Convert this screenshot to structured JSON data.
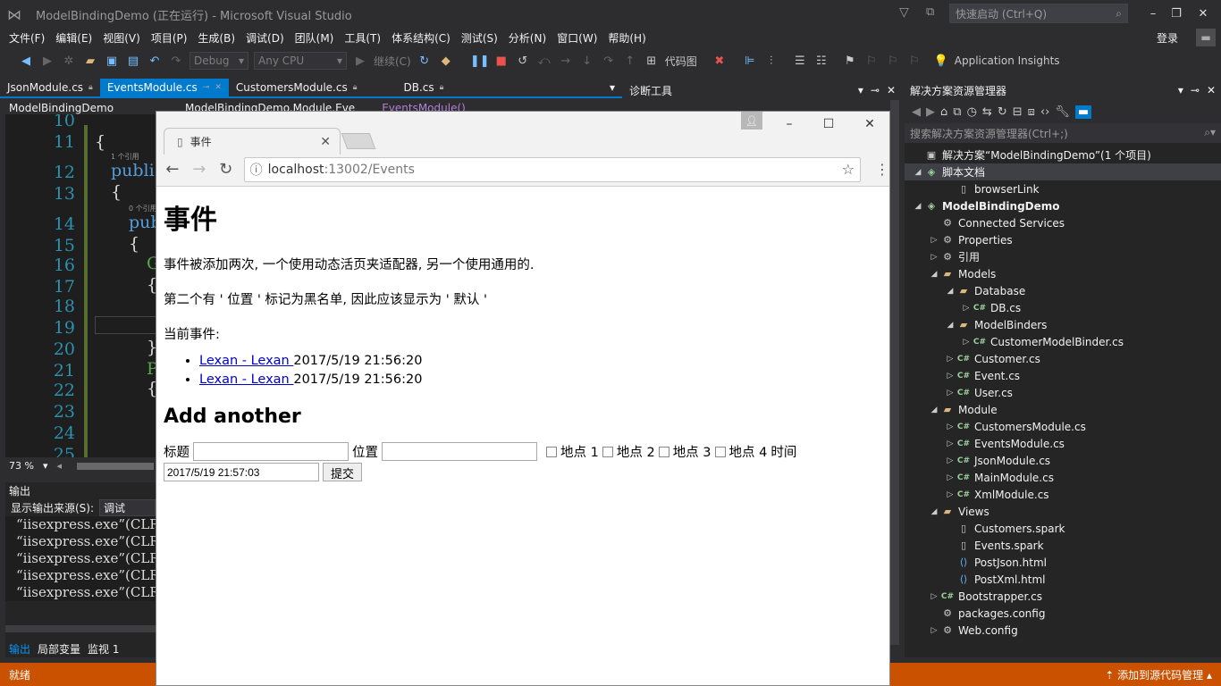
{
  "window": {
    "title": "ModelBindingDemo (正在运行) - Microsoft Visual Studio",
    "quick_launch": "快速启动 (Ctrl+Q)",
    "sign_in": "登录"
  },
  "menu": [
    "文件(F)",
    "编辑(E)",
    "视图(V)",
    "项目(P)",
    "生成(B)",
    "调试(D)",
    "团队(M)",
    "工具(T)",
    "体系结构(C)",
    "测试(S)",
    "分析(N)",
    "窗口(W)",
    "帮助(H)"
  ],
  "toolbar": {
    "config": "Debug",
    "platform": "Any CPU",
    "continue": "继续(C)",
    "code_map": "代码图",
    "app_insights": "Application Insights"
  },
  "doc_tabs": [
    "JsonModule.cs",
    "EventsModule.cs",
    "CustomersModule.cs",
    "DB.cs"
  ],
  "navbar": {
    "project": "ModelBindingDemo",
    "namespace": "ModelBindingDemo.Module.Eve",
    "member": "EventsModule()"
  },
  "editor": {
    "line_numbers": [
      "10",
      "11",
      "12",
      "13",
      "14",
      "15",
      "16",
      "17",
      "18",
      "19",
      "20",
      "21",
      "22",
      "23",
      "24",
      "25"
    ],
    "refs1": "1 个引用",
    "refs0": "0 个引用",
    "zoom": "73 %"
  },
  "output": {
    "title": "输出",
    "source_label": "显示输出来源(S):",
    "source_value": "调试",
    "lines": [
      "“iisexpress.exe”(CLR",
      "“iisexpress.exe”(CLR",
      "“iisexpress.exe”(CLR",
      "“iisexpress.exe”(CLR",
      "“iisexpress.exe”(CLR"
    ],
    "tabs": [
      "输出",
      "局部变量",
      "监视 1"
    ]
  },
  "diag": {
    "title": "诊断工具"
  },
  "solution_explorer": {
    "title": "解决方案资源管理器",
    "search": "搜索解决方案资源管理器(Ctrl+;)",
    "tree": [
      {
        "label": "解决方案“ModelBindingDemo”(1 个项目)",
        "depth": 0,
        "toggle": "",
        "icon": "sol"
      },
      {
        "label": "脚本文档",
        "depth": 0,
        "toggle": "◢",
        "icon": "proj",
        "selected": true
      },
      {
        "label": "browserLink",
        "depth": 2,
        "toggle": "",
        "icon": "file"
      },
      {
        "label": "ModelBindingDemo",
        "depth": 0,
        "toggle": "◢",
        "icon": "proj",
        "bold": true
      },
      {
        "label": "Connected Services",
        "depth": 1,
        "toggle": "",
        "icon": "cfg"
      },
      {
        "label": "Properties",
        "depth": 1,
        "toggle": "▷",
        "icon": "cfg"
      },
      {
        "label": "引用",
        "depth": 1,
        "toggle": "▷",
        "icon": "cfg"
      },
      {
        "label": "Models",
        "depth": 1,
        "toggle": "◢",
        "icon": "folder"
      },
      {
        "label": "Database",
        "depth": 2,
        "toggle": "◢",
        "icon": "folder"
      },
      {
        "label": "DB.cs",
        "depth": 3,
        "toggle": "▷",
        "icon": "cs"
      },
      {
        "label": "ModelBinders",
        "depth": 2,
        "toggle": "◢",
        "icon": "folder"
      },
      {
        "label": "CustomerModelBinder.cs",
        "depth": 3,
        "toggle": "▷",
        "icon": "cs"
      },
      {
        "label": "Customer.cs",
        "depth": 2,
        "toggle": "▷",
        "icon": "cs"
      },
      {
        "label": "Event.cs",
        "depth": 2,
        "toggle": "▷",
        "icon": "cs"
      },
      {
        "label": "User.cs",
        "depth": 2,
        "toggle": "▷",
        "icon": "cs"
      },
      {
        "label": "Module",
        "depth": 1,
        "toggle": "◢",
        "icon": "folder"
      },
      {
        "label": "CustomersModule.cs",
        "depth": 2,
        "toggle": "▷",
        "icon": "cs"
      },
      {
        "label": "EventsModule.cs",
        "depth": 2,
        "toggle": "▷",
        "icon": "cs"
      },
      {
        "label": "JsonModule.cs",
        "depth": 2,
        "toggle": "▷",
        "icon": "cs"
      },
      {
        "label": "MainModule.cs",
        "depth": 2,
        "toggle": "▷",
        "icon": "cs"
      },
      {
        "label": "XmlModule.cs",
        "depth": 2,
        "toggle": "▷",
        "icon": "cs"
      },
      {
        "label": "Views",
        "depth": 1,
        "toggle": "◢",
        "icon": "folder"
      },
      {
        "label": "Customers.spark",
        "depth": 2,
        "toggle": "",
        "icon": "file"
      },
      {
        "label": "Events.spark",
        "depth": 2,
        "toggle": "",
        "icon": "file"
      },
      {
        "label": "PostJson.html",
        "depth": 2,
        "toggle": "",
        "icon": "html"
      },
      {
        "label": "PostXml.html",
        "depth": 2,
        "toggle": "",
        "icon": "html"
      },
      {
        "label": "Bootstrapper.cs",
        "depth": 1,
        "toggle": "▷",
        "icon": "cs"
      },
      {
        "label": "packages.config",
        "depth": 1,
        "toggle": "",
        "icon": "cfg"
      },
      {
        "label": "Web.config",
        "depth": 1,
        "toggle": "▷",
        "icon": "cfg"
      }
    ]
  },
  "status": {
    "left": "就绪",
    "right": "添加到源代码管理"
  },
  "browser": {
    "tab_title": "事件",
    "url_host": "localhost",
    "url_rest": ":13002/Events",
    "page": {
      "heading": "事件",
      "p1": "事件被添加两次, 一个使用动态活页夹适配器, 另一个使用通用的.",
      "p2": "第二个有 ' 位置 ' 标记为黑名单, 因此应该显示为 ' 默认 '",
      "p3": "当前事件:",
      "events": [
        {
          "link": "Lexan - Lexan ",
          "time": "2017/5/19 21:56:20"
        },
        {
          "link": "Lexan - Lexan ",
          "time": "2017/5/19 21:56:20"
        }
      ],
      "h2": "Add another",
      "form": {
        "title_label": "标题",
        "location_label": "位置",
        "places": [
          "地点 1",
          "地点 2",
          "地点 3",
          "地点 4"
        ],
        "time_label": "时间",
        "time_value": "2017/5/19 21:57:03",
        "submit": "提交"
      }
    }
  }
}
